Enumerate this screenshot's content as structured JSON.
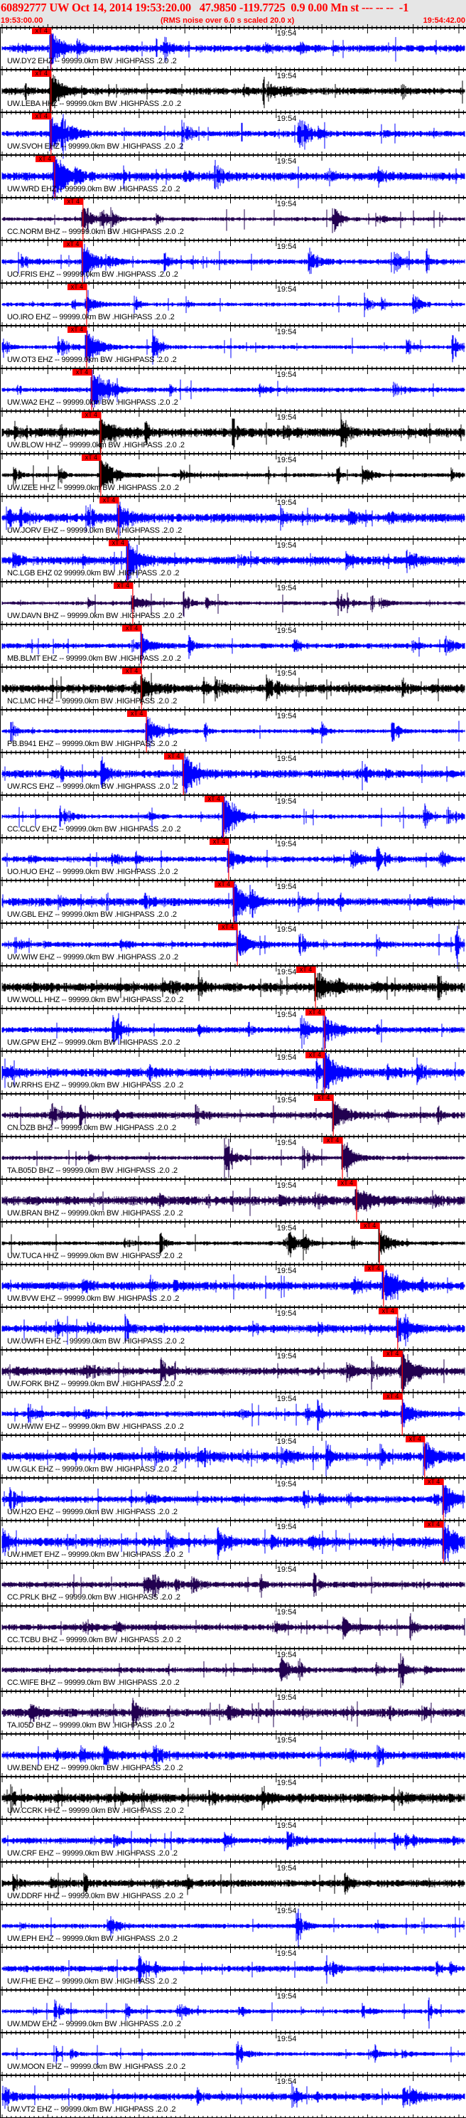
{
  "header": {
    "title": "60892777 UW Oct 14, 2014 19:53:20.00   47.9850 -119.7725  0.9 0.00 Mn st --- -- --  -1",
    "start_time": "19:53:00.00",
    "note": "(RMS noise over 6.0 s scaled 20.0 x)",
    "end_time": "19:54:42.00"
  },
  "colors": {
    "blue": "#0000ff",
    "purple": "#220050",
    "black": "#000000",
    "pick": "#ff0000",
    "header_bg": "#e6e6e6"
  },
  "chart_data": {
    "type": "line",
    "title": "60892777 UW Oct 14, 2014 19:53:20.00",
    "x_unit": "seconds after 19:53:00.00",
    "xlim": [
      0,
      102
    ],
    "major_tick_s": 10,
    "minor_tick_s": 1,
    "time_marker_label": "19:54",
    "time_marker_s": 60,
    "pick_label": "xT 4",
    "traces": [
      {
        "label": "UW.DY2 EHZ -- 99999.0km BW .HIGHPASS .2.0 .2",
        "color": "blue",
        "pick_s": 10.7
      },
      {
        "label": "UW.LEBA HHZ -- 99999.0km BW .HIGHPASS .2.0 .2",
        "color": "black",
        "pick_s": 10.7
      },
      {
        "label": "UW.SVOH EHZ -- 99999.0km BW .HIGHPASS .2.0 .2",
        "color": "blue",
        "pick_s": 10.7
      },
      {
        "label": "UW.WRD EHZ -- 99999.0km BW .HIGHPASS .2.0 .2",
        "color": "blue",
        "pick_s": 11.5
      },
      {
        "label": "CC.NORM BHZ -- 99999.0km BW .HIGHPASS .2.0 .2",
        "color": "purple",
        "pick_s": 17.7
      },
      {
        "label": "UO.FRIS EHZ -- 99999.0km BW .HIGHPASS .2.0 .2",
        "color": "blue",
        "pick_s": 17.6
      },
      {
        "label": "UO.IRO EHZ -- 99999.0km BW .HIGHPASS .2.0 .2",
        "color": "blue",
        "pick_s": 18.5
      },
      {
        "label": "UW.OT3 EHZ -- 99999.0km BW .HIGHPASS .2.0 .2",
        "color": "blue",
        "pick_s": 18.5
      },
      {
        "label": "UW.WA2 EHZ -- 99999.0km BW .HIGHPASS .2.0 .2",
        "color": "blue",
        "pick_s": 19.6
      },
      {
        "label": "UW.BLOW HHZ -- 99999.0km BW .HIGHPASS .2.0 .2",
        "color": "black",
        "pick_s": 21.6
      },
      {
        "label": "UW.IZEE HHZ -- 99999.0km BW .HIGHPASS .2.0 .2",
        "color": "black",
        "pick_s": 21.6
      },
      {
        "label": "UW.JORV EHZ -- 99999.0km BW .HIGHPASS .2.0 .2",
        "color": "blue",
        "pick_s": 25.5
      },
      {
        "label": "NC.LGB EHZ 02 99999.0km BW .HIGHPASS .2.0 .2",
        "color": "blue",
        "pick_s": 27.5
      },
      {
        "label": "UW.DAVN BHZ -- 99999.0km BW .HIGHPASS .2.0 .2",
        "color": "purple",
        "pick_s": 28.6
      },
      {
        "label": "MB.BLMT EHZ -- 99999.0km BW .HIGHPASS .2.0 .2",
        "color": "blue",
        "pick_s": 30.5
      },
      {
        "label": "NC.LMC HHZ -- 99999.0km BW .HIGHPASS .2.0 .2",
        "color": "black",
        "pick_s": 30.5
      },
      {
        "label": "PB.B941 EHZ -- 99999.0km BW .HIGHPASS .2.0 .2",
        "color": "blue",
        "pick_s": 31.6
      },
      {
        "label": "UW.RCS EHZ -- 99999.0km BW .HIGHPASS .2.0 .2",
        "color": "blue",
        "pick_s": 39.7
      },
      {
        "label": "CC.CLCV EHZ -- 99999.0km BW .HIGHPASS .2.0 .2",
        "color": "blue",
        "pick_s": 48.5
      },
      {
        "label": "UO.HUO EHZ -- 99999.0km BW .HIGHPASS .2.0 .2",
        "color": "blue",
        "pick_s": 49.6
      },
      {
        "label": "UW.GBL EHZ -- 99999.0km BW .HIGHPASS .2.0 .2",
        "color": "blue",
        "pick_s": 50.7
      },
      {
        "label": "UW.WIW EHZ -- 99999.0km BW .HIGHPASS .2.0 .2",
        "color": "blue",
        "pick_s": 51.5
      },
      {
        "label": "UW.WOLL HHZ -- 99999.0km BW .HIGHPASS .2.0 .2",
        "color": "black",
        "pick_s": 68.6
      },
      {
        "label": "UW.GPW EHZ -- 99999.0km BW .HIGHPASS .2.0 .2",
        "color": "blue",
        "pick_s": 70.6
      },
      {
        "label": "UW.RRHS EHZ -- 99999.0km BW .HIGHPASS .2.0 .2",
        "color": "blue",
        "pick_s": 70.6
      },
      {
        "label": "CN.OZB BHZ -- 99999.0km BW .HIGHPASS .2.0 .2",
        "color": "purple",
        "pick_s": 72.5
      },
      {
        "label": "TA.B05D BHZ -- 99999.0km BW .HIGHPASS .2.0 .2",
        "color": "purple",
        "pick_s": 74.5
      },
      {
        "label": "UW.BRAN BHZ -- 99999.0km BW .HIGHPASS .2.0 .2",
        "color": "purple",
        "pick_s": 77.6
      },
      {
        "label": "UW.TUCA HHZ -- 99999.0km BW .HIGHPASS .2.0 .2",
        "color": "black",
        "pick_s": 82.6
      },
      {
        "label": "UW.BVW EHZ -- 99999.0km BW .HIGHPASS .2.0 .2",
        "color": "blue",
        "pick_s": 83.5
      },
      {
        "label": "UW.UWFH EHZ -- 99999.0km BW .HIGHPASS .2.0 .2",
        "color": "blue",
        "pick_s": 86.6
      },
      {
        "label": "UW.FORK BHZ -- 99999.0km BW .HIGHPASS .2.0 .2",
        "color": "purple",
        "pick_s": 87.6
      },
      {
        "label": "UW.HWIW EHZ -- 99999.0km BW .HIGHPASS .2.0 .2",
        "color": "blue",
        "pick_s": 87.6
      },
      {
        "label": "UW.GLK EHZ -- 99999.0km BW .HIGHPASS .2.0 .2",
        "color": "blue",
        "pick_s": 92.5
      },
      {
        "label": "UW.H2O EHZ -- 99999.0km BW .HIGHPASS .2.0 .2",
        "color": "blue",
        "pick_s": 96.6
      },
      {
        "label": "UW.HMET EHZ -- 99999.0km BW .HIGHPASS .2.0 .2",
        "color": "blue",
        "pick_s": 96.6
      },
      {
        "label": "CC.PRLK BHZ -- 99999.0km BW .HIGHPASS .2.0 .2",
        "color": "purple",
        "pick_s": null
      },
      {
        "label": "CC.TCBU BHZ -- 99999.0km BW .HIGHPASS .2.0 .2",
        "color": "purple",
        "pick_s": null
      },
      {
        "label": "CC.WIFE BHZ -- 99999.0km BW .HIGHPASS .2.0 .2",
        "color": "purple",
        "pick_s": null
      },
      {
        "label": "TA.I05D BHZ -- 99999.0km BW .HIGHPASS .2.0 .2",
        "color": "purple",
        "pick_s": null
      },
      {
        "label": "UW.BEND EHZ -- 99999.0km BW .HIGHPASS .2.0 .2",
        "color": "blue",
        "pick_s": null
      },
      {
        "label": "UW.CCRK HHZ -- 99999.0km BW .HIGHPASS .2.0 .2",
        "color": "black",
        "pick_s": null
      },
      {
        "label": "UW.CRF EHZ -- 99999.0km BW .HIGHPASS .2.0 .2",
        "color": "blue",
        "pick_s": null
      },
      {
        "label": "UW.DDRF HHZ -- 99999.0km BW .HIGHPASS .2.0 .2",
        "color": "black",
        "pick_s": null
      },
      {
        "label": "UW.EPH EHZ -- 99999.0km BW .HIGHPASS .2.0 .2",
        "color": "blue",
        "pick_s": null
      },
      {
        "label": "UW.FHE EHZ -- 99999.0km BW .HIGHPASS .2.0 .2",
        "color": "blue",
        "pick_s": null
      },
      {
        "label": "UW.MDW EHZ -- 99999.0km BW .HIGHPASS .2.0 .2",
        "color": "blue",
        "pick_s": null
      },
      {
        "label": "UW.MOON EHZ -- 99999.0km BW .HIGHPASS .2.0 .2",
        "color": "blue",
        "pick_s": null
      },
      {
        "label": "UW.VT2 EHZ -- 99999.0km BW .HIGHPASS .2.0 .2",
        "color": "blue",
        "pick_s": null
      }
    ]
  }
}
